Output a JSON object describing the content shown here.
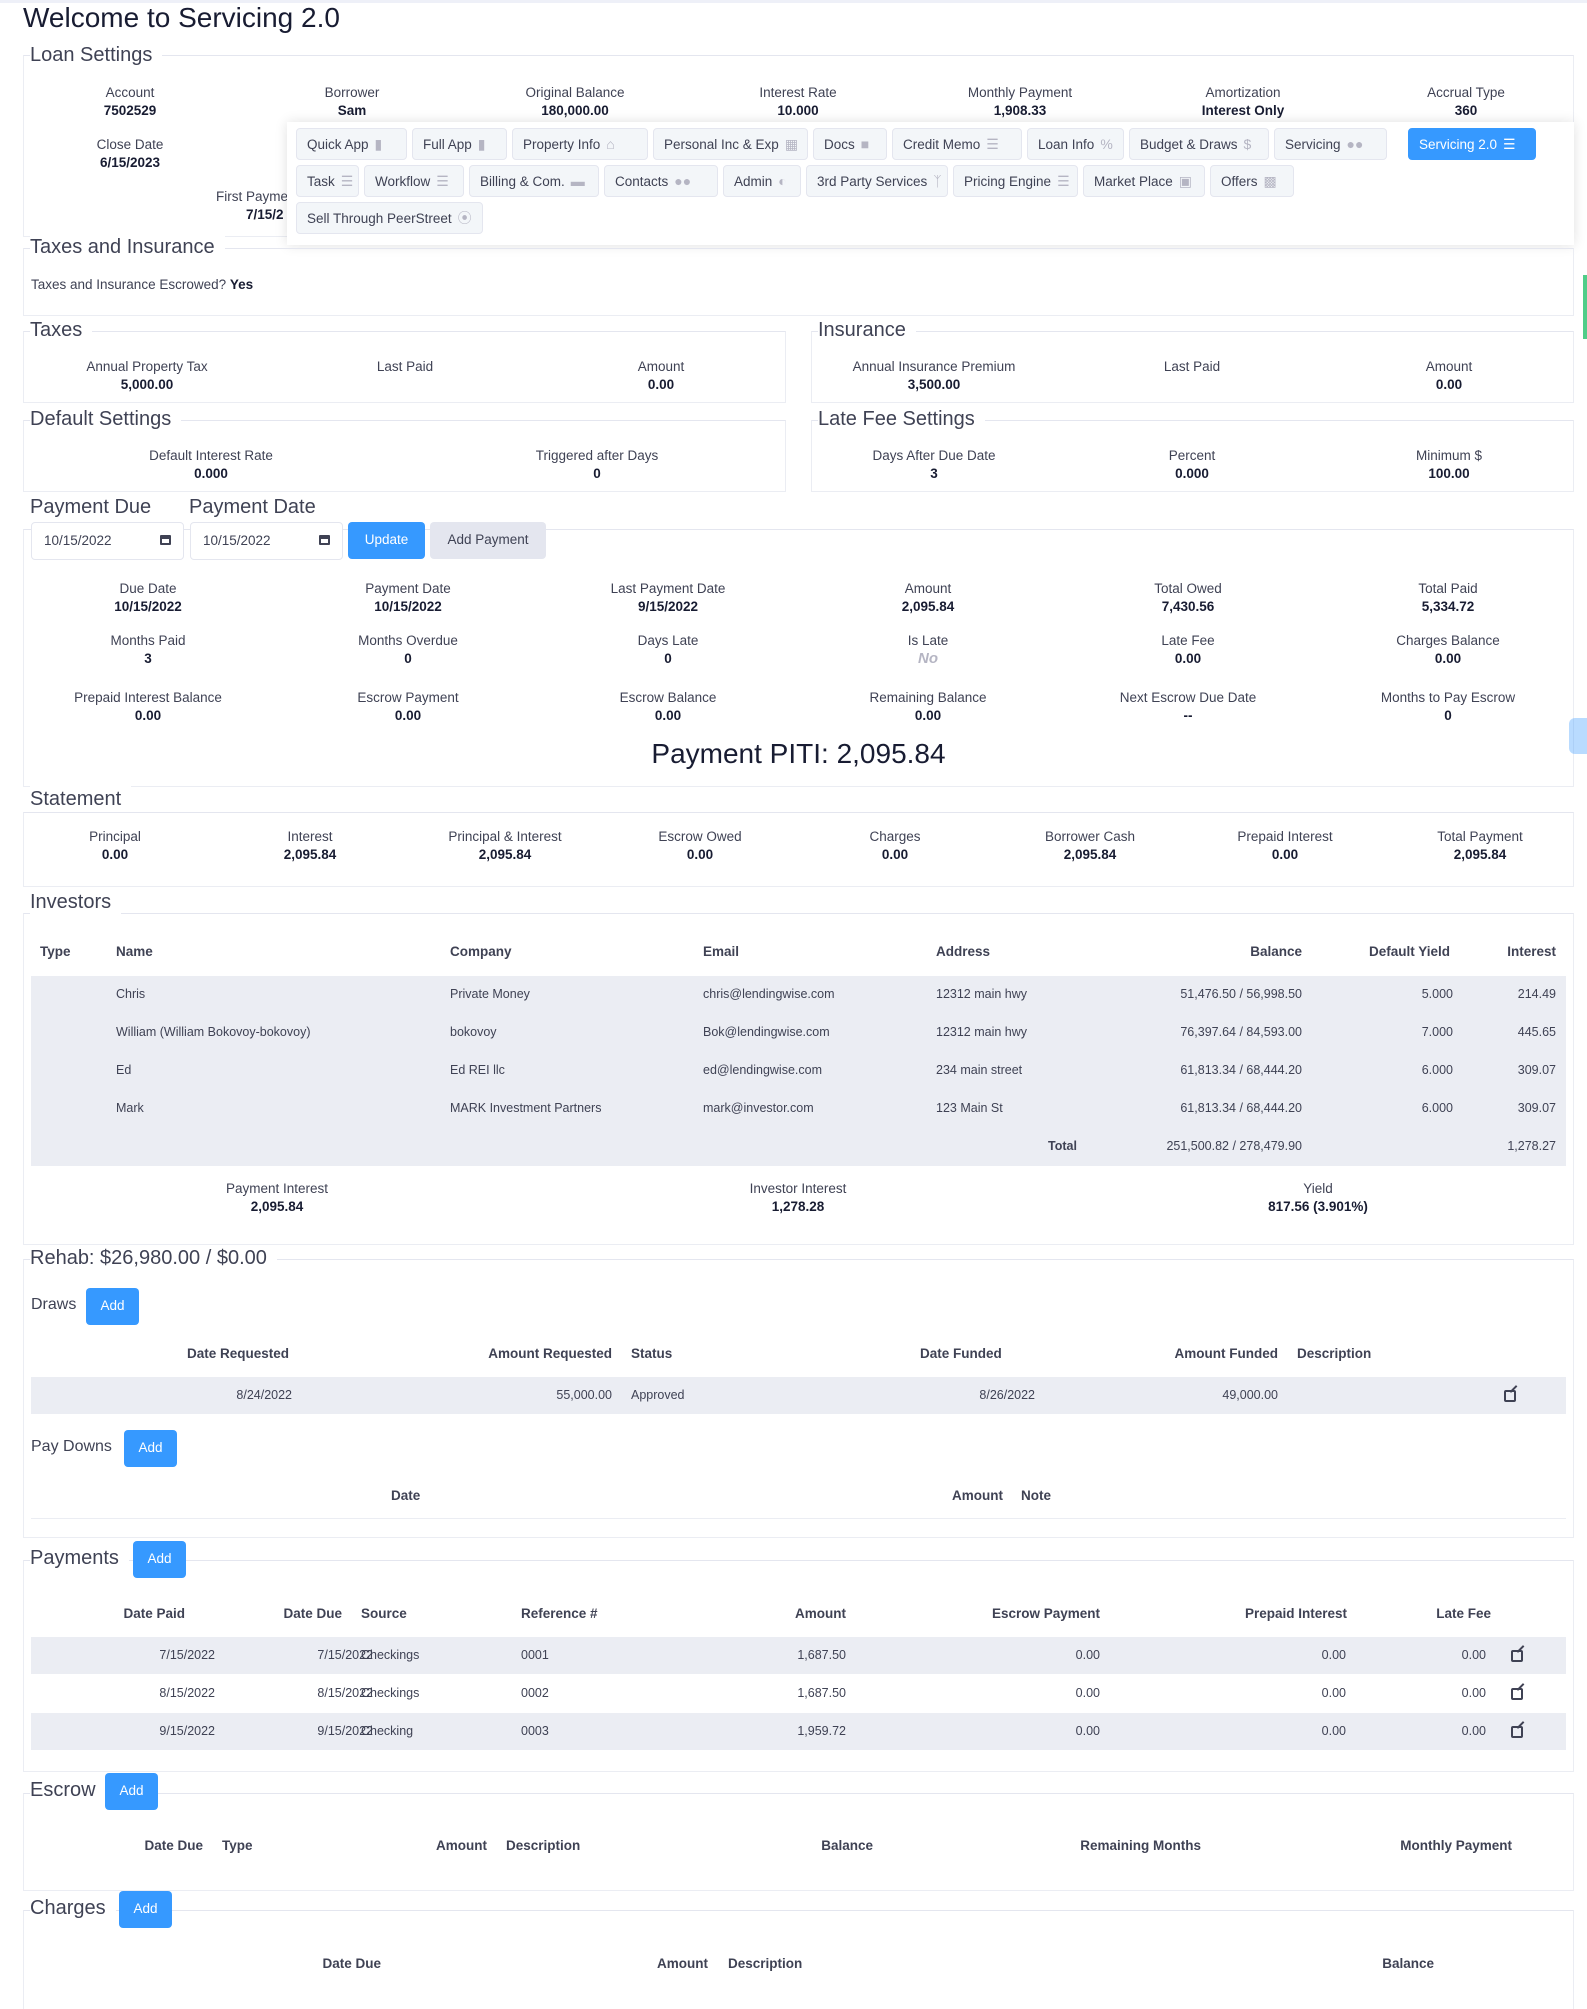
{
  "page_title": "Welcome to Servicing 2.0",
  "loan_settings": {
    "title": "Loan Settings",
    "fields": [
      {
        "label": "Account",
        "value": "7502529"
      },
      {
        "label": "Borrower",
        "value": "Sam"
      },
      {
        "label": "Original Balance",
        "value": "180,000.00"
      },
      {
        "label": "Interest Rate",
        "value": "10.000"
      },
      {
        "label": "Monthly Payment",
        "value": "1,908.33"
      },
      {
        "label": "Amortization",
        "value": "Interest Only"
      },
      {
        "label": "Accrual Type",
        "value": "360"
      }
    ],
    "close_date": {
      "label": "Close Date",
      "value": "6/15/2023"
    },
    "first_payment": {
      "label": "First Payme",
      "value": "7/15/2"
    }
  },
  "nav_menu": [
    {
      "label": "Quick App",
      "icon": "document-icon"
    },
    {
      "label": "Full App",
      "icon": "document-icon"
    },
    {
      "label": "Property Info",
      "icon": "home-icon"
    },
    {
      "label": "Personal Inc & Exp",
      "icon": "calculator-icon"
    },
    {
      "label": "Docs",
      "icon": "folder-icon"
    },
    {
      "label": "Credit Memo",
      "icon": "list-icon"
    },
    {
      "label": "Loan Info",
      "icon": "percent-icon"
    },
    {
      "label": "Budget & Draws",
      "icon": "dollar-icon"
    },
    {
      "label": "Servicing",
      "icon": "handshake-icon"
    },
    {
      "label": "Servicing 2.0",
      "icon": "list-icon",
      "active": true
    },
    {
      "label": "Task",
      "icon": "checklist-icon"
    },
    {
      "label": "Workflow",
      "icon": "checklist-icon"
    },
    {
      "label": "Billing & Com.",
      "icon": "credit-card-icon"
    },
    {
      "label": "Contacts",
      "icon": "users-icon"
    },
    {
      "label": "Admin",
      "icon": "shield-icon"
    },
    {
      "label": "3rd Party Services",
      "icon": "branch-icon"
    },
    {
      "label": "Pricing Engine",
      "icon": "list-icon"
    },
    {
      "label": "Market Place",
      "icon": "cart-icon"
    },
    {
      "label": "Offers",
      "icon": "gift-icon"
    },
    {
      "label": "Sell Through PeerStreet",
      "icon": "rss-icon"
    }
  ],
  "taxes_insurance": {
    "title": "Taxes and Insurance",
    "escrowed_label": "Taxes and Insurance Escrowed?",
    "escrowed_value": "Yes"
  },
  "taxes": {
    "title": "Taxes",
    "fields": [
      {
        "label": "Annual Property Tax",
        "value": "5,000.00"
      },
      {
        "label": "Last Paid",
        "value": ""
      },
      {
        "label": "Amount",
        "value": "0.00"
      }
    ]
  },
  "insurance": {
    "title": "Insurance",
    "fields": [
      {
        "label": "Annual Insurance Premium",
        "value": "3,500.00"
      },
      {
        "label": "Last Paid",
        "value": ""
      },
      {
        "label": "Amount",
        "value": "0.00"
      }
    ]
  },
  "default_settings": {
    "title": "Default Settings",
    "fields": [
      {
        "label": "Default Interest Rate",
        "value": "0.000"
      },
      {
        "label": "Triggered after Days",
        "value": "0"
      }
    ]
  },
  "late_fee_settings": {
    "title": "Late Fee Settings",
    "fields": [
      {
        "label": "Days After Due Date",
        "value": "3"
      },
      {
        "label": "Percent",
        "value": "0.000"
      },
      {
        "label": "Minimum $",
        "value": "100.00"
      }
    ]
  },
  "payment_due": {
    "due_title": "Payment Due",
    "date_title": "Payment Date",
    "due_value": "10/15/2022",
    "date_value": "10/15/2022",
    "update_label": "Update",
    "add_payment_label": "Add Payment",
    "rows": [
      [
        {
          "label": "Due Date",
          "value": "10/15/2022"
        },
        {
          "label": "Payment Date",
          "value": "10/15/2022"
        },
        {
          "label": "Last Payment Date",
          "value": "9/15/2022"
        },
        {
          "label": "Amount",
          "value": "2,095.84"
        },
        {
          "label": "Total Owed",
          "value": "7,430.56"
        },
        {
          "label": "Total Paid",
          "value": "5,334.72"
        }
      ],
      [
        {
          "label": "Months Paid",
          "value": "3"
        },
        {
          "label": "Months Overdue",
          "value": "0"
        },
        {
          "label": "Days Late",
          "value": "0"
        },
        {
          "label": "Is Late",
          "value": "No"
        },
        {
          "label": "Late Fee",
          "value": "0.00"
        },
        {
          "label": "Charges Balance",
          "value": "0.00"
        }
      ],
      [
        {
          "label": "Prepaid Interest Balance",
          "value": "0.00"
        },
        {
          "label": "Escrow Payment",
          "value": "0.00"
        },
        {
          "label": "Escrow Balance",
          "value": "0.00"
        },
        {
          "label": "Remaining Balance",
          "value": "0.00"
        },
        {
          "label": "Next Escrow Due Date",
          "value": "--"
        },
        {
          "label": "Months to Pay Escrow",
          "value": "0"
        }
      ]
    ],
    "piti": "Payment PITI: 2,095.84"
  },
  "statement": {
    "title": "Statement",
    "fields": [
      {
        "label": "Principal",
        "value": "0.00"
      },
      {
        "label": "Interest",
        "value": "2,095.84"
      },
      {
        "label": "Principal & Interest",
        "value": "2,095.84"
      },
      {
        "label": "Escrow Owed",
        "value": "0.00"
      },
      {
        "label": "Charges",
        "value": "0.00"
      },
      {
        "label": "Borrower Cash",
        "value": "2,095.84"
      },
      {
        "label": "Prepaid Interest",
        "value": "0.00"
      },
      {
        "label": "Total Payment",
        "value": "2,095.84"
      }
    ]
  },
  "investors": {
    "title": "Investors",
    "headers": [
      "Type",
      "Name",
      "Company",
      "Email",
      "Address",
      "Balance",
      "Default Yield",
      "Interest"
    ],
    "rows": [
      [
        "",
        "Chris",
        "Private Money",
        "chris@lendingwise.com",
        "12312 main hwy",
        "51,476.50 / 56,998.50",
        "5.000",
        "214.49"
      ],
      [
        "",
        "William (William Bokovoy-bokovoy)",
        "bokovoy",
        "Bok@lendingwise.com",
        "12312 main hwy",
        "76,397.64 / 84,593.00",
        "7.000",
        "445.65"
      ],
      [
        "",
        "Ed",
        "Ed REI llc",
        "ed@lendingwise.com",
        "234 main street",
        "61,813.34 / 68,444.20",
        "6.000",
        "309.07"
      ],
      [
        "",
        "Mark",
        "MARK Investment Partners",
        "mark@investor.com",
        "123 Main St",
        "61,813.34 / 68,444.20",
        "6.000",
        "309.07"
      ]
    ],
    "total_label": "Total",
    "total_balance": "251,500.82 / 278,479.90",
    "total_interest": "1,278.27",
    "summary": [
      {
        "label": "Payment Interest",
        "value": "2,095.84"
      },
      {
        "label": "Investor Interest",
        "value": "1,278.28"
      },
      {
        "label": "Yield",
        "value": "817.56 (3.901%)"
      }
    ]
  },
  "rehab": {
    "title": "Rehab: $26,980.00 / $0.00",
    "draws": {
      "title": "Draws",
      "add_label": "Add",
      "headers": [
        "Date Requested",
        "Amount Requested",
        "Status",
        "Date Funded",
        "Amount Funded",
        "Description"
      ],
      "rows": [
        [
          "8/24/2022",
          "55,000.00",
          "Approved",
          "8/26/2022",
          "49,000.00",
          ""
        ]
      ]
    },
    "paydowns": {
      "title": "Pay Downs",
      "add_label": "Add",
      "headers": [
        "Date",
        "Amount",
        "Note"
      ]
    }
  },
  "payments": {
    "title": "Payments",
    "add_label": "Add",
    "headers": [
      "Date Paid",
      "Date Due",
      "Source",
      "Reference #",
      "Amount",
      "Escrow Payment",
      "Prepaid Interest",
      "Late Fee"
    ],
    "rows": [
      [
        "7/15/2022",
        "7/15/2022",
        "Checkings",
        "0001",
        "1,687.50",
        "0.00",
        "0.00",
        "0.00"
      ],
      [
        "8/15/2022",
        "8/15/2022",
        "Checkings",
        "0002",
        "1,687.50",
        "0.00",
        "0.00",
        "0.00"
      ],
      [
        "9/15/2022",
        "9/15/2022",
        "Checking",
        "0003",
        "1,959.72",
        "0.00",
        "0.00",
        "0.00"
      ]
    ]
  },
  "escrow": {
    "title": "Escrow",
    "add_label": "Add",
    "headers": [
      "Date Due",
      "Type",
      "Amount",
      "Description",
      "Balance",
      "Remaining Months",
      "Monthly Payment"
    ]
  },
  "charges": {
    "title": "Charges",
    "add_label": "Add",
    "headers": [
      "Date Due",
      "Amount",
      "Description",
      "Balance"
    ]
  }
}
